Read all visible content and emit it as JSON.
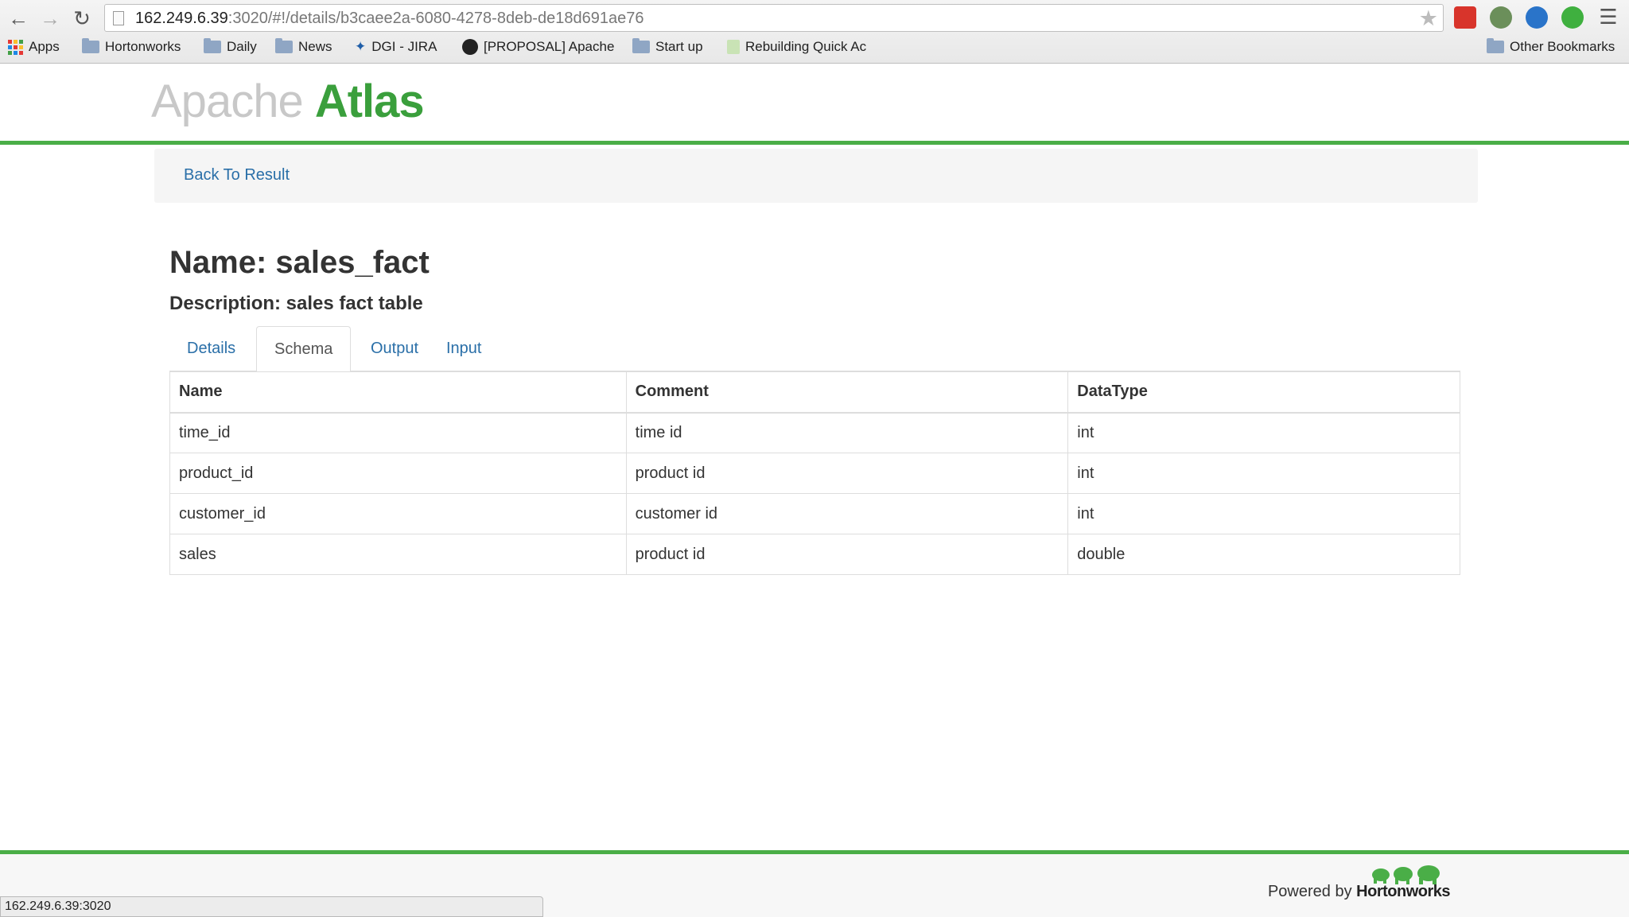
{
  "browser": {
    "url_host": "162.249.6.39",
    "url_rest": ":3020/#!/details/b3caee2a-6080-4278-8deb-de18d691ae76",
    "bookmarks": [
      {
        "label": "Apps",
        "icon": "apps-grid-icon"
      },
      {
        "label": "Hortonworks",
        "icon": "folder-icon"
      },
      {
        "label": "Daily",
        "icon": "folder-icon"
      },
      {
        "label": "News",
        "icon": "folder-icon"
      },
      {
        "label": "DGI - JIRA",
        "icon": "jira-icon"
      },
      {
        "label": "[PROPOSAL] Apache",
        "icon": "github-icon"
      },
      {
        "label": "Start up",
        "icon": "folder-icon"
      },
      {
        "label": "Rebuilding Quick Ac",
        "icon": "page-icon"
      }
    ],
    "other_bookmarks": "Other Bookmarks",
    "status_text": "162.249.6.39:3020"
  },
  "header": {
    "logo_apache": "Apache",
    "logo_atlas": "Atlas",
    "accent_color": "#4aae47"
  },
  "back_link": "Back To Result",
  "entity": {
    "name": "Name: sales_fact",
    "description": "Description: sales fact table"
  },
  "tabs": [
    {
      "label": "Details",
      "active": false
    },
    {
      "label": "Schema",
      "active": true
    },
    {
      "label": "Output",
      "active": false
    },
    {
      "label": "Input",
      "active": false
    }
  ],
  "schema_table": {
    "headers": [
      "Name",
      "Comment",
      "DataType"
    ],
    "rows": [
      [
        "time_id",
        "time id",
        "int"
      ],
      [
        "product_id",
        "product id",
        "int"
      ],
      [
        "customer_id",
        "customer id",
        "int"
      ],
      [
        "sales",
        "product id",
        "double"
      ]
    ]
  },
  "footer": {
    "powered_by": "Powered by",
    "brand": "Hortonworks"
  }
}
